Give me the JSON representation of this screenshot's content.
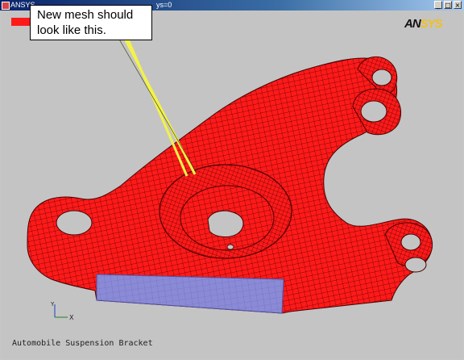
{
  "window": {
    "title": "ANSYS",
    "title_suffix": "ys=0",
    "minimize_label": "_",
    "maximize_label": "□",
    "close_label": "×"
  },
  "callout": {
    "line1": "New mesh should",
    "line2": "look like this."
  },
  "logo": {
    "part1": "AN",
    "part2": "SYS"
  },
  "triad": {
    "x_label": "X",
    "y_label": "Y"
  },
  "caption": "Automobile Suspension Bracket",
  "colors": {
    "mesh_red": "#ff1a1a",
    "mesh_lines": "#5a0000",
    "selected_area": "#8a8ad6",
    "callout_pointer": "#f2f24a",
    "background": "#c4c4c4"
  }
}
